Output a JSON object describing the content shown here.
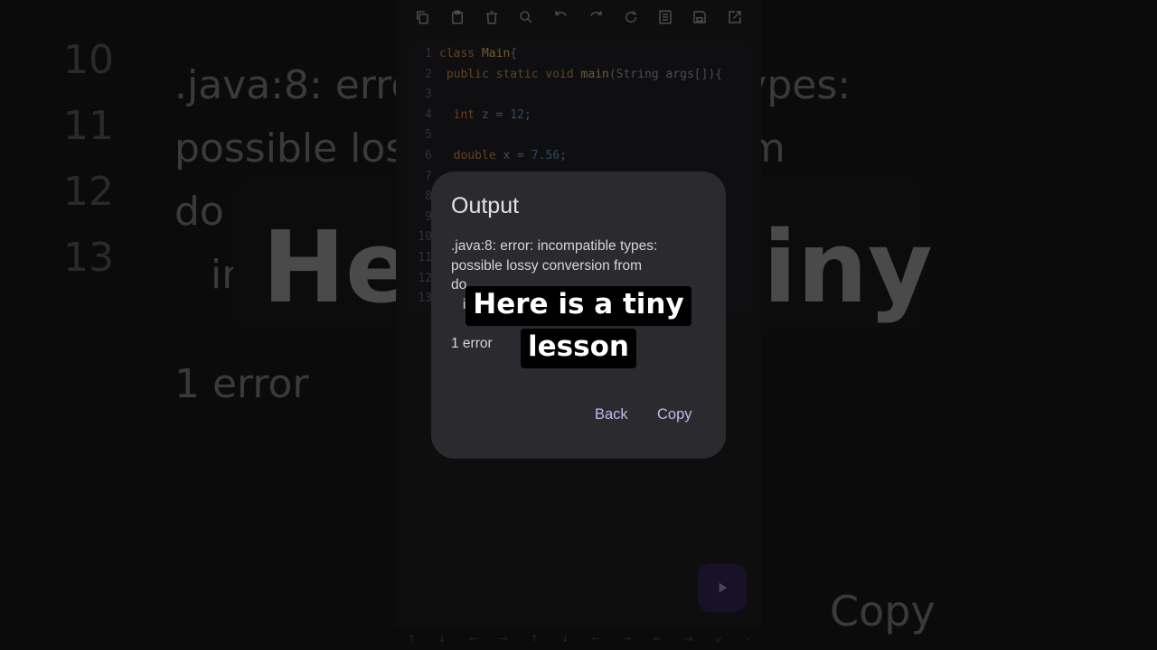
{
  "background": {
    "line_numbers": [
      "10",
      "11",
      "12",
      "13"
    ],
    "message_lines": [
      ".java:8: error: incompatible types:",
      "possible lossy conversion from",
      "do",
      "in"
    ],
    "error_count": "1 error",
    "caption_left": "He",
    "caption_right": "iny",
    "copy_label": "Copy"
  },
  "toolbar": {
    "icons": [
      "copy-icon",
      "clipboard-icon",
      "delete-icon",
      "search-replace-icon",
      "undo-icon",
      "redo-icon",
      "refresh-icon",
      "format-icon",
      "save-icon",
      "open-external-icon"
    ]
  },
  "editor": {
    "lines": [
      {
        "n": "1",
        "segments": [
          {
            "t": "class ",
            "c": "kw"
          },
          {
            "t": "Main",
            "c": "fn"
          },
          {
            "t": "{",
            "c": "code"
          }
        ]
      },
      {
        "n": "2",
        "segments": [
          {
            "t": " public static void ",
            "c": "kw"
          },
          {
            "t": "main",
            "c": "fn"
          },
          {
            "t": "(String args[]){",
            "c": "code"
          }
        ]
      },
      {
        "n": "3",
        "segments": []
      },
      {
        "n": "4",
        "segments": [
          {
            "t": "  int ",
            "c": "kw"
          },
          {
            "t": "z = ",
            "c": "code"
          },
          {
            "t": "12",
            "c": "num"
          },
          {
            "t": ";",
            "c": "code"
          }
        ]
      },
      {
        "n": "5",
        "segments": []
      },
      {
        "n": "6",
        "segments": [
          {
            "t": "  double ",
            "c": "kw"
          },
          {
            "t": "x = ",
            "c": "code"
          },
          {
            "t": "7.56",
            "c": "num"
          },
          {
            "t": ";",
            "c": "code"
          }
        ]
      },
      {
        "n": "7",
        "segments": []
      },
      {
        "n": "8",
        "segments": []
      },
      {
        "n": "9",
        "segments": []
      },
      {
        "n": "10",
        "segments": []
      },
      {
        "n": "11",
        "segments": []
      },
      {
        "n": "12",
        "segments": []
      },
      {
        "n": "13",
        "segments": []
      }
    ]
  },
  "keys": [
    "↑",
    "↓",
    "←",
    "→",
    "↑",
    "↓",
    "←",
    "→",
    "⇤",
    "⇥",
    "↙",
    "›"
  ],
  "dialog": {
    "title": "Output",
    "message": ".java:8: error: incompatible types:\npossible lossy conversion from\ndo\n   in",
    "error_count": "1 error",
    "back_label": "Back",
    "copy_label": "Copy"
  },
  "caption": {
    "line1": "Here is a tiny",
    "line2": "lesson"
  }
}
